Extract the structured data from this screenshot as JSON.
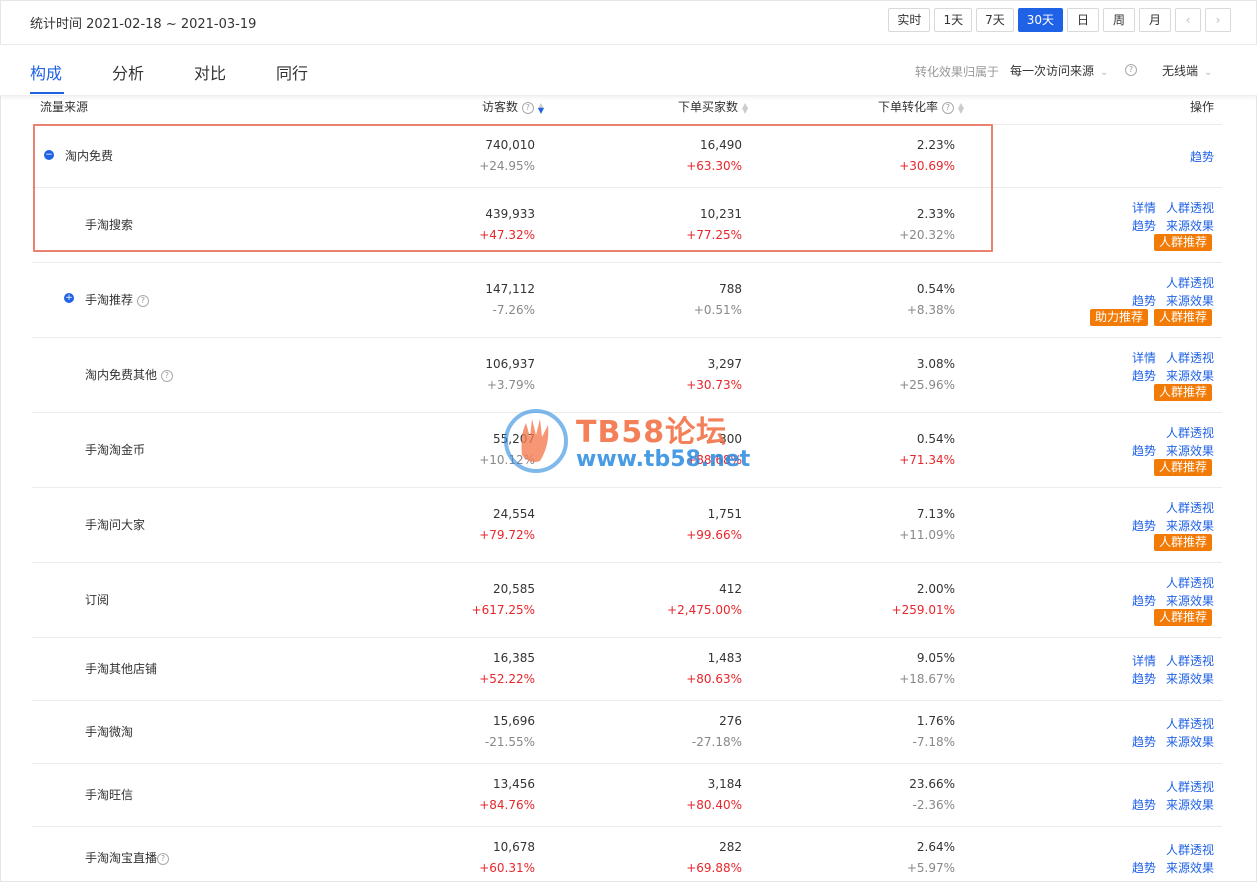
{
  "date_range": {
    "label": "统计时间 2021-02-18 ~ 2021-03-19"
  },
  "period_buttons": [
    "实时",
    "1天",
    "7天",
    "30天",
    "日",
    "周",
    "月"
  ],
  "active_period": "30天",
  "tabs": [
    "构成",
    "分析",
    "对比",
    "同行"
  ],
  "active_tab": "构成",
  "attribution": {
    "label": "转化效果归属于",
    "value": "每一次访问来源"
  },
  "device": {
    "value": "无线端"
  },
  "columns": {
    "source": "流量来源",
    "visitors": "访客数",
    "buyers": "下单买家数",
    "rate": "下单转化率",
    "action": "操作"
  },
  "rows": [
    {
      "name": "淘内免费",
      "visitors": "740,010",
      "visitors_chg": "+24.95%",
      "buyers": "16,490",
      "buyers_chg": "+63.30%",
      "rate": "2.23%",
      "rate_chg": "+30.69%"
    },
    {
      "name": "手淘搜索",
      "visitors": "439,933",
      "visitors_chg": "+47.32%",
      "buyers": "10,231",
      "buyers_chg": "+77.25%",
      "rate": "2.33%",
      "rate_chg": "+20.32%"
    },
    {
      "name": "手淘推荐",
      "visitors": "147,112",
      "visitors_chg": "-7.26%",
      "buyers": "788",
      "buyers_chg": "+0.51%",
      "rate": "0.54%",
      "rate_chg": "+8.38%"
    },
    {
      "name": "淘内免费其他",
      "visitors": "106,937",
      "visitors_chg": "+3.79%",
      "buyers": "3,297",
      "buyers_chg": "+30.73%",
      "rate": "3.08%",
      "rate_chg": "+25.96%"
    },
    {
      "name": "手淘淘金币",
      "visitors": "55,207",
      "visitors_chg": "+10.12%",
      "buyers": "300",
      "buyers_chg": "+88.68%",
      "rate": "0.54%",
      "rate_chg": "+71.34%"
    },
    {
      "name": "手淘问大家",
      "visitors": "24,554",
      "visitors_chg": "+79.72%",
      "buyers": "1,751",
      "buyers_chg": "+99.66%",
      "rate": "7.13%",
      "rate_chg": "+11.09%"
    },
    {
      "name": "订阅",
      "visitors": "20,585",
      "visitors_chg": "+617.25%",
      "buyers": "412",
      "buyers_chg": "+2,475.00%",
      "rate": "2.00%",
      "rate_chg": "+259.01%"
    },
    {
      "name": "手淘其他店铺",
      "visitors": "16,385",
      "visitors_chg": "+52.22%",
      "buyers": "1,483",
      "buyers_chg": "+80.63%",
      "rate": "9.05%",
      "rate_chg": "+18.67%"
    },
    {
      "name": "手淘微淘",
      "visitors": "15,696",
      "visitors_chg": "-21.55%",
      "buyers": "276",
      "buyers_chg": "-27.18%",
      "rate": "1.76%",
      "rate_chg": "-7.18%"
    },
    {
      "name": "手淘旺信",
      "visitors": "13,456",
      "visitors_chg": "+84.76%",
      "buyers": "3,184",
      "buyers_chg": "+80.40%",
      "rate": "23.66%",
      "rate_chg": "-2.36%"
    },
    {
      "name": "手淘淘宝直播",
      "visitors": "10,678",
      "visitors_chg": "+60.31%",
      "buyers": "282",
      "buyers_chg": "+69.88%",
      "rate": "2.64%",
      "rate_chg": "+5.97%"
    }
  ],
  "actions": {
    "detail": "详情",
    "crowd": "人群透视",
    "trend": "趋势",
    "source_effect": "来源效果",
    "crowd_push": "人群推荐",
    "boost_push": "助力推荐"
  },
  "watermark": {
    "title": "TB58论坛",
    "url": "www.tb58.net"
  },
  "colors": {
    "accent": "#2062e6",
    "up": "#e8262b",
    "badge": "#f27b07",
    "highlight": "#e9826f"
  }
}
